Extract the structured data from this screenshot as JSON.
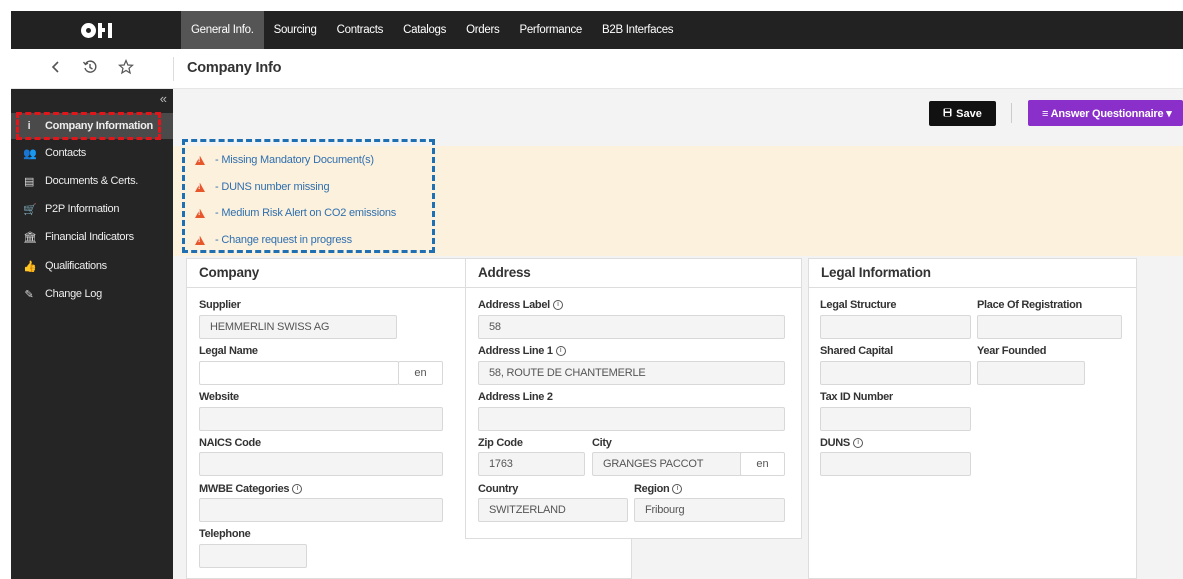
{
  "topbar": {
    "tabs": [
      {
        "label": "General Info."
      },
      {
        "label": "Sourcing"
      },
      {
        "label": "Contracts"
      },
      {
        "label": "Catalogs"
      },
      {
        "label": "Orders"
      },
      {
        "label": "Performance"
      },
      {
        "label": "B2B Interfaces"
      }
    ],
    "active_tab": "General Info."
  },
  "subbar": {
    "icons": [
      "chevron-left-icon",
      "history-icon",
      "star-icon"
    ],
    "page_title": "Company Info"
  },
  "sidebar": {
    "items": [
      {
        "label": "Company Information",
        "icon": "info-icon",
        "glyph": "i"
      },
      {
        "label": "Contacts",
        "icon": "users-icon",
        "glyph": "👥"
      },
      {
        "label": "Documents & Certs.",
        "icon": "document-icon",
        "glyph": "▤"
      },
      {
        "label": "P2P Information",
        "icon": "cart-icon",
        "glyph": "🛒"
      },
      {
        "label": "Financial Indicators",
        "icon": "bank-icon",
        "glyph": "🏛"
      },
      {
        "label": "Qualifications",
        "icon": "thumbs-up-icon",
        "glyph": "👍"
      },
      {
        "label": "Change Log",
        "icon": "edit-icon",
        "glyph": "✎"
      }
    ],
    "active_item": "Company Information"
  },
  "actions": {
    "save_label": "Save",
    "answer_label": "≡ Answer Questionnaire ▾"
  },
  "alerts": [
    {
      "text": "- Missing Mandatory Document(s)"
    },
    {
      "text": "- DUNS number missing"
    },
    {
      "text": "- Medium Risk Alert on CO2 emissions"
    },
    {
      "text": "- Change request in progress"
    }
  ],
  "company": {
    "title": "Company",
    "supplier_label": "Supplier",
    "supplier_value": "HEMMERLIN SWISS AG",
    "legal_name_label": "Legal Name",
    "legal_name_value": "",
    "legal_name_lang": "en",
    "website_label": "Website",
    "naics_label": "NAICS Code",
    "mwbe_label": "MWBE Categories",
    "telephone_label": "Telephone"
  },
  "address": {
    "title": "Address",
    "label_label": "Address Label",
    "label_value": "58",
    "line1_label": "Address Line 1",
    "line1_value": "58, ROUTE DE CHANTEMERLE",
    "line2_label": "Address Line 2",
    "zip_label": "Zip Code",
    "zip_value": "1763",
    "city_label": "City",
    "city_value": "GRANGES PACCOT",
    "city_lang": "en",
    "country_label": "Country",
    "country_value": "SWITZERLAND",
    "region_label": "Region",
    "region_value": "Fribourg"
  },
  "legal": {
    "title": "Legal Information",
    "legal_structure_label": "Legal Structure",
    "place_of_registration_label": "Place Of Registration",
    "shared_capital_label": "Shared Capital",
    "year_founded_label": "Year Founded",
    "tax_id_label": "Tax ID Number",
    "duns_label": "DUNS"
  },
  "colors": {
    "topbar": "#222222",
    "sidebar": "#252525",
    "answer_button": "#8a2fc9",
    "alert_bg": "#fcf1dc",
    "alert_text": "#2e6fb0",
    "warning_icon": "#e8572b",
    "red_highlight": "#e0161a",
    "blue_highlight": "#1f6fb3"
  }
}
